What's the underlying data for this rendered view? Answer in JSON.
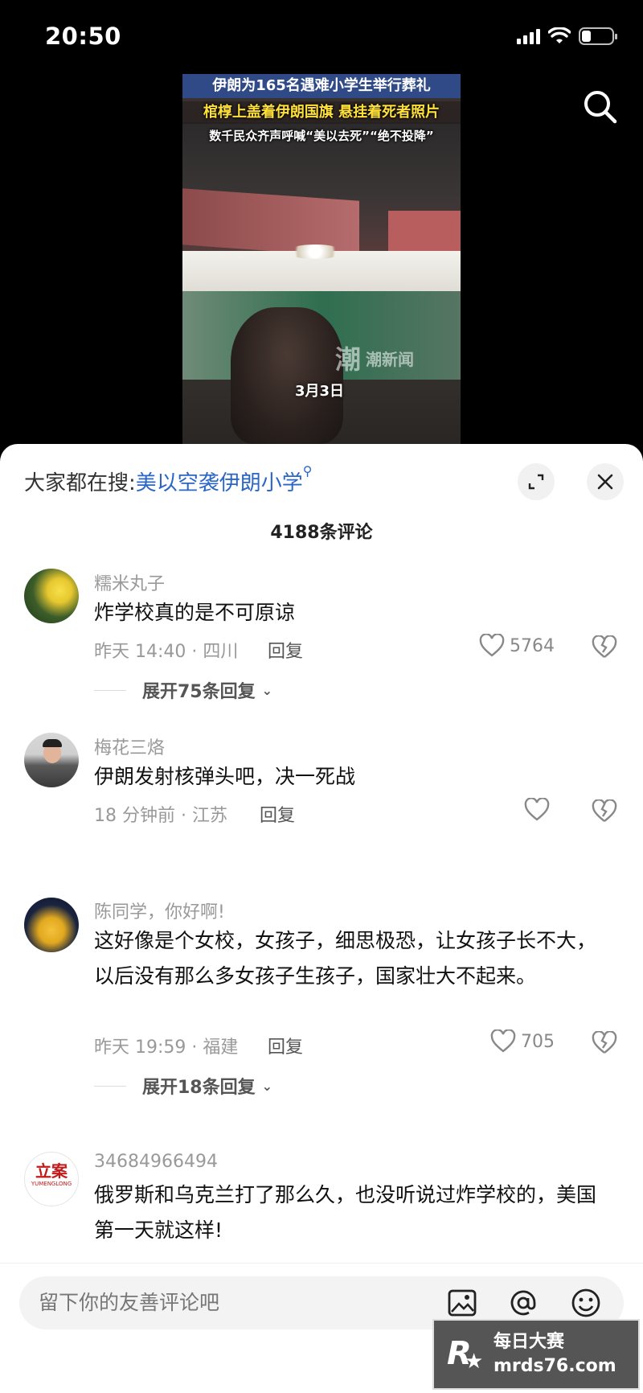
{
  "status_bar": {
    "time": "20:50",
    "battery_level_pct": 30
  },
  "video": {
    "caption_line1": "伊朗为165名遇难小学生举行葬礼",
    "caption_line2": "棺椁上盖着伊朗国旗 悬挂着死者照片",
    "caption_line3": "数千民众齐声呼喊“美以去死”“绝不投降”",
    "date_label": "3月3日",
    "watermark": "潮新闻",
    "watermark_logo": "潮"
  },
  "sheet": {
    "hot_search_prefix": "大家都在搜:",
    "hot_search_term": "美以空袭伊朗小学",
    "comment_count": "4188条评论",
    "reply_label": "回复"
  },
  "comments": [
    {
      "user": "糯米丸子",
      "text": "炸学校真的是不可原谅",
      "meta": "昨天 14:40 · 四川",
      "likes": "5764",
      "expand": "展开75条回复"
    },
    {
      "user": "梅花三烙",
      "text": "伊朗发射核弹头吧，决一死战",
      "meta": "18 分钟前 · 江苏",
      "likes": ""
    },
    {
      "user": "陈同学，你好啊!",
      "text": "这好像是个女校，女孩子，细思极恐，让女孩子长不大，以后没有那么多女孩子生孩子，国家壮大不起来。",
      "meta": "昨天 19:59 · 福建",
      "likes": "705",
      "expand": "展开18条回复"
    },
    {
      "user": "34684966494",
      "text": "俄罗斯和乌克兰打了那么久，也没听说过炸学校的，美国第一天就这样!",
      "avatar_text": "立案",
      "avatar_subtext": "YUMENGLONG"
    }
  ],
  "input": {
    "placeholder": "留下你的友善评论吧"
  },
  "promo": {
    "line1": "每日大赛",
    "line2": "mrds76.com",
    "logo_letter": "R"
  },
  "colors": {
    "accent": "#2b66c6",
    "caption_bg": "#2f4a86",
    "caption_yellow": "#ffe03a"
  }
}
